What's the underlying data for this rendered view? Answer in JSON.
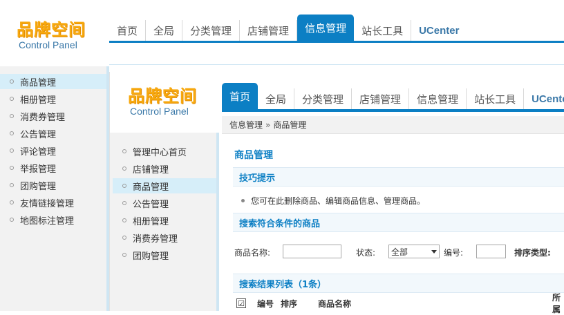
{
  "logo": {
    "cn": "品牌空间",
    "en": "Control Panel"
  },
  "outer_nav": {
    "tabs": [
      {
        "label": "首页"
      },
      {
        "label": "全局"
      },
      {
        "label": "分类管理"
      },
      {
        "label": "店铺管理"
      },
      {
        "label": "信息管理",
        "active": true
      },
      {
        "label": "站长工具"
      },
      {
        "label": "UCenter"
      }
    ]
  },
  "outer_sidebar": {
    "items": [
      {
        "label": "商品管理",
        "active": true
      },
      {
        "label": "相册管理"
      },
      {
        "label": "消费券管理"
      },
      {
        "label": "公告管理"
      },
      {
        "label": "评论管理"
      },
      {
        "label": "举报管理"
      },
      {
        "label": "团购管理"
      },
      {
        "label": "友情链接管理"
      },
      {
        "label": "地图标注管理"
      }
    ]
  },
  "inner_nav": {
    "tabs": [
      {
        "label": "首页",
        "active": true
      },
      {
        "label": "全局"
      },
      {
        "label": "分类管理"
      },
      {
        "label": "店铺管理"
      },
      {
        "label": "信息管理"
      },
      {
        "label": "站长工具"
      },
      {
        "label": "UCenter"
      }
    ]
  },
  "inner_sidebar": {
    "items": [
      {
        "label": "管理中心首页"
      },
      {
        "label": "店铺管理"
      },
      {
        "label": "商品管理",
        "active": true
      },
      {
        "label": "公告管理"
      },
      {
        "label": "相册管理"
      },
      {
        "label": "消费券管理"
      },
      {
        "label": "团购管理"
      }
    ]
  },
  "breadcrumb": {
    "parent": "信息管理",
    "separator": "»",
    "current": "商品管理"
  },
  "main": {
    "title": "商品管理",
    "tips_header": "技巧提示",
    "tip": "您可在此删除商品、编辑商品信息、管理商品。",
    "search_header": "搜索符合条件的商品",
    "search": {
      "name_label": "商品名称:",
      "name_value": "",
      "status_label": "状态:",
      "status_value": "全部",
      "id_label": "编号:",
      "id_value": "",
      "sort_label": "排序类型:"
    },
    "results_header": "搜索结果列表（1条）",
    "table": {
      "checkbox_mark": "☑",
      "columns": [
        "编号",
        "排序",
        "商品名称",
        "所属"
      ]
    }
  }
}
